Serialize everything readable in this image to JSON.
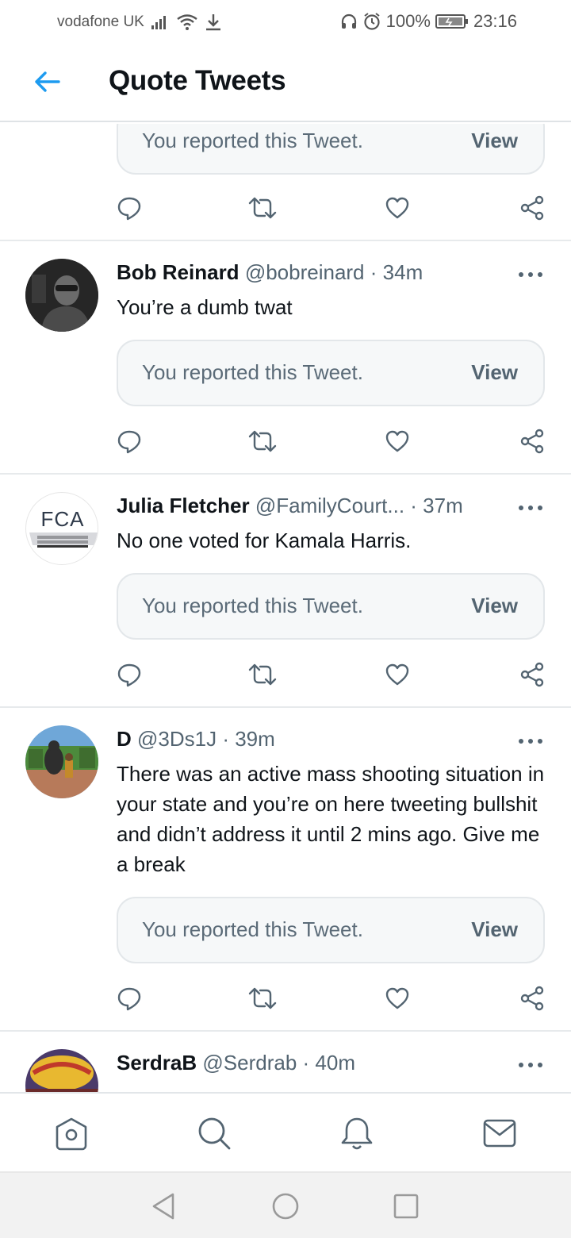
{
  "status_bar": {
    "carrier": "vodafone UK",
    "battery": "100%",
    "time": "23:16"
  },
  "header": {
    "title": "Quote Tweets"
  },
  "tweets": [
    {
      "reported_text": "You reported this Tweet.",
      "view_label": "View"
    },
    {
      "name": "Bob Reinard",
      "handle": "@bobreinard",
      "time": "· 34m",
      "text": "You’re a dumb twat",
      "reported_text": "You reported this Tweet.",
      "view_label": "View"
    },
    {
      "name": "Julia Fletcher",
      "handle": "@FamilyCourt...",
      "time": " · 37m",
      "avatar_text": "FCA",
      "text": "No one voted for Kamala Harris.",
      "reported_text": "You reported this Tweet.",
      "view_label": "View"
    },
    {
      "name": "D",
      "handle": "@3Ds1J",
      "time": "· 39m",
      "text": "There was an active mass shooting situation in your state and you’re on here tweeting bullshit and didn’t address it until 2 mins ago. Give me a break",
      "reported_text": "You reported this Tweet.",
      "view_label": "View"
    },
    {
      "name": "SerdraB",
      "handle": "@Serdrab",
      "time": "· 40m"
    }
  ],
  "icons": {
    "reply": "comment-icon",
    "retweet": "retweet-icon",
    "like": "heart-icon",
    "share": "share-icon"
  },
  "colors": {
    "accent": "#1d9bf0",
    "icon_gray": "#536471"
  }
}
